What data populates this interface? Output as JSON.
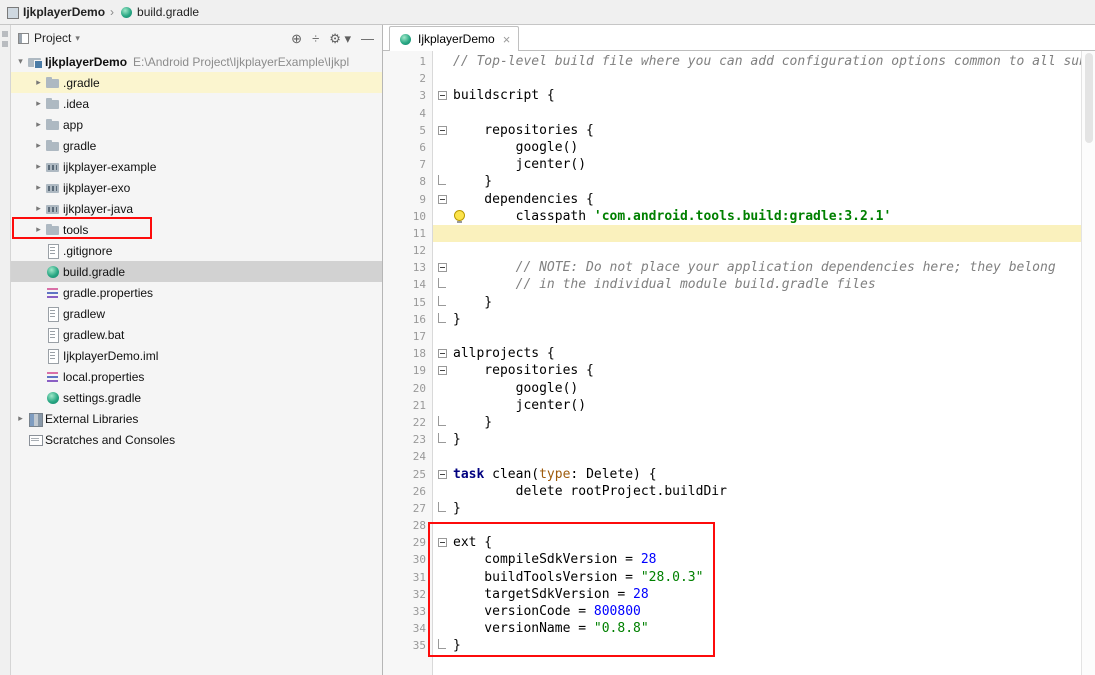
{
  "topbar": {
    "breadcrumbs": [
      {
        "label": "IjkplayerDemo"
      },
      {
        "label": "build.gradle"
      }
    ]
  },
  "project_panel": {
    "header": {
      "title": "Project",
      "icons": [
        "locate",
        "collapse-all",
        "settings",
        "hide"
      ]
    },
    "tree": [
      {
        "label": "IjkplayerDemo",
        "icon": "root",
        "indent": 0,
        "chevron": "down",
        "bold": true,
        "path": "E:\\Android Project\\IjkplayerExample\\Ijkpl"
      },
      {
        "label": ".gradle",
        "icon": "folder",
        "indent": 1,
        "chevron": "right",
        "highlighted": true
      },
      {
        "label": ".idea",
        "icon": "folder",
        "indent": 1,
        "chevron": "right"
      },
      {
        "label": "app",
        "icon": "folder",
        "indent": 1,
        "chevron": "right"
      },
      {
        "label": "gradle",
        "icon": "folder",
        "indent": 1,
        "chevron": "right"
      },
      {
        "label": "ijkplayer-example",
        "icon": "module",
        "indent": 1,
        "chevron": "right"
      },
      {
        "label": "ijkplayer-exo",
        "icon": "module",
        "indent": 1,
        "chevron": "right"
      },
      {
        "label": "ijkplayer-java",
        "icon": "module",
        "indent": 1,
        "chevron": "right"
      },
      {
        "label": "tools",
        "icon": "folder",
        "indent": 1,
        "chevron": "right",
        "boxed": true
      },
      {
        "label": ".gitignore",
        "icon": "file",
        "indent": 1
      },
      {
        "label": "build.gradle",
        "icon": "gradle",
        "indent": 1,
        "selected": true
      },
      {
        "label": "gradle.properties",
        "icon": "properties",
        "indent": 1
      },
      {
        "label": "gradlew",
        "icon": "file",
        "indent": 1
      },
      {
        "label": "gradlew.bat",
        "icon": "file",
        "indent": 1
      },
      {
        "label": "IjkplayerDemo.iml",
        "icon": "file",
        "indent": 1
      },
      {
        "label": "local.properties",
        "icon": "properties",
        "indent": 1
      },
      {
        "label": "settings.gradle",
        "icon": "gradle",
        "indent": 1
      },
      {
        "label": "External Libraries",
        "icon": "library",
        "indent": 0,
        "chevron": "right"
      },
      {
        "label": "Scratches and Consoles",
        "icon": "scratch",
        "indent": 0
      }
    ]
  },
  "editor": {
    "tab": {
      "title": "IjkplayerDemo",
      "icon": "gradle"
    },
    "lightbulb_line": 10,
    "caret_line": 11,
    "lines": [
      {
        "n": 1,
        "seg": [
          {
            "t": "// Top-level build file where you can add configuration options common to all sub",
            "c": "cm"
          }
        ]
      },
      {
        "n": 2,
        "seg": []
      },
      {
        "n": 3,
        "fold": "start",
        "seg": [
          {
            "t": "buildscript {"
          }
        ]
      },
      {
        "n": 4,
        "seg": []
      },
      {
        "n": 5,
        "fold": "start",
        "seg": [
          {
            "t": "    repositories {"
          }
        ]
      },
      {
        "n": 6,
        "seg": [
          {
            "t": "        google()"
          }
        ]
      },
      {
        "n": 7,
        "seg": [
          {
            "t": "        jcenter()"
          }
        ]
      },
      {
        "n": 8,
        "fold": "end",
        "seg": [
          {
            "t": "    }"
          }
        ]
      },
      {
        "n": 9,
        "fold": "start",
        "seg": [
          {
            "t": "    dependencies {"
          }
        ]
      },
      {
        "n": 10,
        "seg": [
          {
            "t": "        classpath "
          },
          {
            "t": "'com.android.tools.build:gradle:3.2.1'",
            "c": "strb"
          }
        ]
      },
      {
        "n": 11,
        "hl": true,
        "seg": []
      },
      {
        "n": 12,
        "seg": []
      },
      {
        "n": 13,
        "fold": "start",
        "seg": [
          {
            "t": "        // NOTE: Do not place your application dependencies here; they belong",
            "c": "cm"
          }
        ]
      },
      {
        "n": 14,
        "fold": "end",
        "seg": [
          {
            "t": "        // in the individual module build.gradle files",
            "c": "cm"
          }
        ]
      },
      {
        "n": 15,
        "fold": "end",
        "seg": [
          {
            "t": "    }"
          }
        ]
      },
      {
        "n": 16,
        "fold": "end",
        "seg": [
          {
            "t": "}"
          }
        ]
      },
      {
        "n": 17,
        "seg": []
      },
      {
        "n": 18,
        "fold": "start",
        "seg": [
          {
            "t": "allprojects {"
          }
        ]
      },
      {
        "n": 19,
        "fold": "start",
        "seg": [
          {
            "t": "    repositories {"
          }
        ]
      },
      {
        "n": 20,
        "seg": [
          {
            "t": "        google()"
          }
        ]
      },
      {
        "n": 21,
        "seg": [
          {
            "t": "        jcenter()"
          }
        ]
      },
      {
        "n": 22,
        "fold": "end",
        "seg": [
          {
            "t": "    }"
          }
        ]
      },
      {
        "n": 23,
        "fold": "end",
        "seg": [
          {
            "t": "}"
          }
        ]
      },
      {
        "n": 24,
        "seg": []
      },
      {
        "n": 25,
        "fold": "start",
        "seg": [
          {
            "t": "task ",
            "c": "kw"
          },
          {
            "t": "clean("
          },
          {
            "t": "type",
            "c": "arg"
          },
          {
            "t": ": Delete) {"
          }
        ]
      },
      {
        "n": 26,
        "seg": [
          {
            "t": "        delete rootProject.buildDir"
          }
        ]
      },
      {
        "n": 27,
        "fold": "end",
        "seg": [
          {
            "t": "}"
          }
        ]
      },
      {
        "n": 28,
        "seg": []
      },
      {
        "n": 29,
        "fold": "start",
        "seg": [
          {
            "t": "ext {"
          }
        ]
      },
      {
        "n": 30,
        "seg": [
          {
            "t": "    compileSdkVersion = "
          },
          {
            "t": "28",
            "c": "num"
          }
        ]
      },
      {
        "n": 31,
        "seg": [
          {
            "t": "    buildToolsVersion = "
          },
          {
            "t": "\"28.0.3\"",
            "c": "str"
          }
        ]
      },
      {
        "n": 32,
        "seg": [
          {
            "t": "    targetSdkVersion = "
          },
          {
            "t": "28",
            "c": "num"
          }
        ]
      },
      {
        "n": 33,
        "seg": [
          {
            "t": "    versionCode = "
          },
          {
            "t": "800800",
            "c": "num"
          }
        ]
      },
      {
        "n": 34,
        "seg": [
          {
            "t": "    versionName = "
          },
          {
            "t": "\"0.8.8\"",
            "c": "str"
          }
        ]
      },
      {
        "n": 35,
        "fold": "end",
        "seg": [
          {
            "t": "}"
          }
        ]
      }
    ]
  },
  "colors": {
    "annotation": "#fd0b0b",
    "selection": "#d2d2d2",
    "caret_line": "#faf1bd",
    "tree_highlight": "#fbf5cf",
    "string": "#008000",
    "number": "#0000ff",
    "keyword": "#000080",
    "comment": "#808080"
  }
}
